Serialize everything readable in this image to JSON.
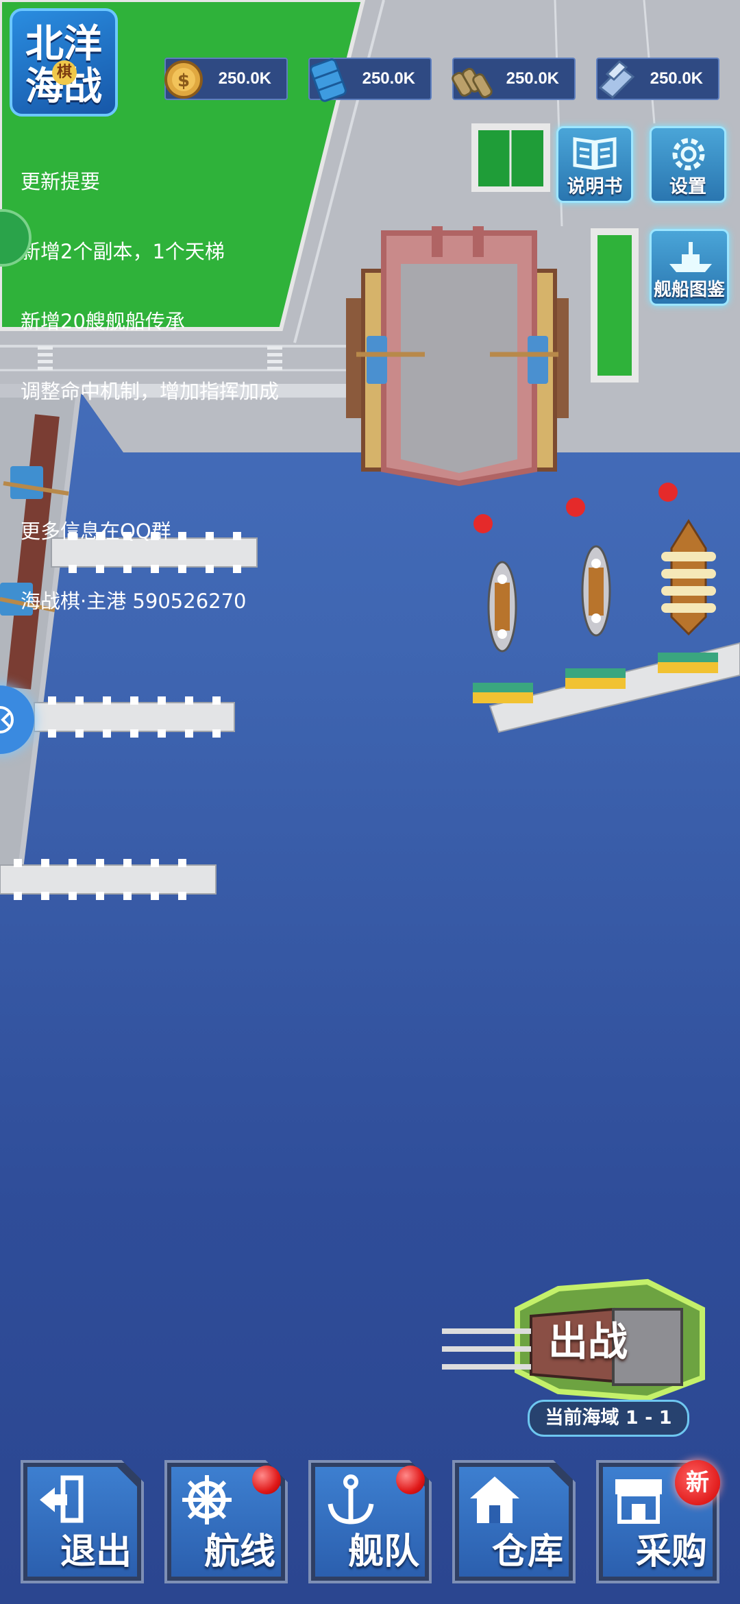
{
  "logo": {
    "text": "北洋海战",
    "sub": "棋"
  },
  "resources": [
    {
      "name": "gold",
      "value": "250.0K",
      "icon": "coin-icon"
    },
    {
      "name": "oil",
      "value": "250.0K",
      "icon": "oil-barrel-icon"
    },
    {
      "name": "ammo",
      "value": "250.0K",
      "icon": "shells-icon"
    },
    {
      "name": "steel",
      "value": "250.0K",
      "icon": "steel-icon"
    }
  ],
  "notice": {
    "lines": [
      "更新提要",
      "新增2个副本，1个天梯",
      "新增20艘舰船传承",
      "调整命中机制，增加指挥加成",
      "",
      "更多信息在QQ群",
      "海战棋·主港 590526270"
    ]
  },
  "top_buttons": {
    "manual": "说明书",
    "settings": "设置",
    "encyclopedia": "舰船图鉴"
  },
  "docks": [
    "1",
    "2",
    "3"
  ],
  "battle": {
    "label": "出战",
    "area": "当前海域 1 - 1"
  },
  "nav": {
    "exit": "退出",
    "route": "航线",
    "fleet": "舰队",
    "warehouse": "仓库",
    "shop": "采购",
    "new_badge": "新"
  },
  "colors": {
    "sea": "#3f66b2",
    "grass": "#2fb23a",
    "button_blue": "#2b5fae",
    "red_dot": "#e01919"
  }
}
